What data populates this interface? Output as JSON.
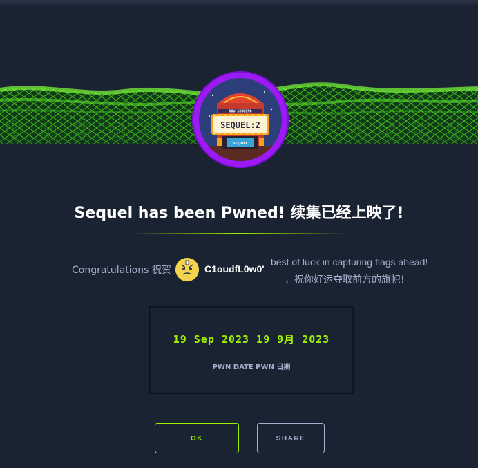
{
  "machine": {
    "marquee_top": "NOW SHOWING",
    "marquee_main": "SEQUEL:2",
    "theater_sign": "SEQUEL"
  },
  "title": "Sequel has been Pwned! 续集已经上映了!",
  "congrats": {
    "label": "Congratulations 祝贺",
    "username": "C1oudfL0w0'",
    "luck_line1": "best of luck in capturing flags ahead!",
    "luck_line2": "，祝你好运夺取前方的旗帜!"
  },
  "pwn": {
    "date": "19 Sep 2023 19 9月 2023",
    "label": "PWN DATE PWN 日期"
  },
  "buttons": {
    "ok": "OK",
    "share": "SHARE"
  },
  "colors": {
    "background": "#1a2332",
    "accent": "#9fef00",
    "ring": "#9c1bf5",
    "muted_text": "#a4b1cd"
  }
}
